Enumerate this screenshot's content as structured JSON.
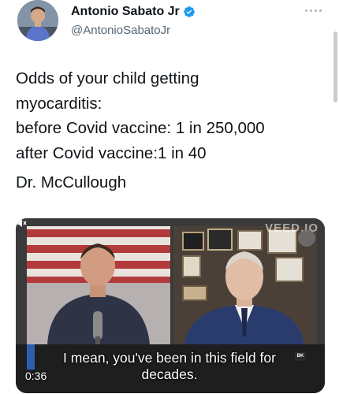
{
  "author": {
    "name": "Antonio Sabato Jr",
    "handle": "@AntonioSabatoJr",
    "avatar_icon": "profile-photo",
    "verified_icon": "verified-badge-icon",
    "verified_color": "#1d9bf0"
  },
  "tweet": {
    "lines": [
      "Odds of your child getting",
      "myocarditis:",
      "before Covid vaccine: 1 in 250,000",
      "after Covid vaccine:1 in 40",
      "Dr. McCullough"
    ]
  },
  "video": {
    "watermark": "VEED.IO",
    "caption_line1": "I mean, you've been in this field for",
    "caption_line2": "decades.",
    "timestamp": "0:36",
    "badge": "BK",
    "icons": [
      "settings-gear-icon",
      "volume-icon"
    ]
  }
}
